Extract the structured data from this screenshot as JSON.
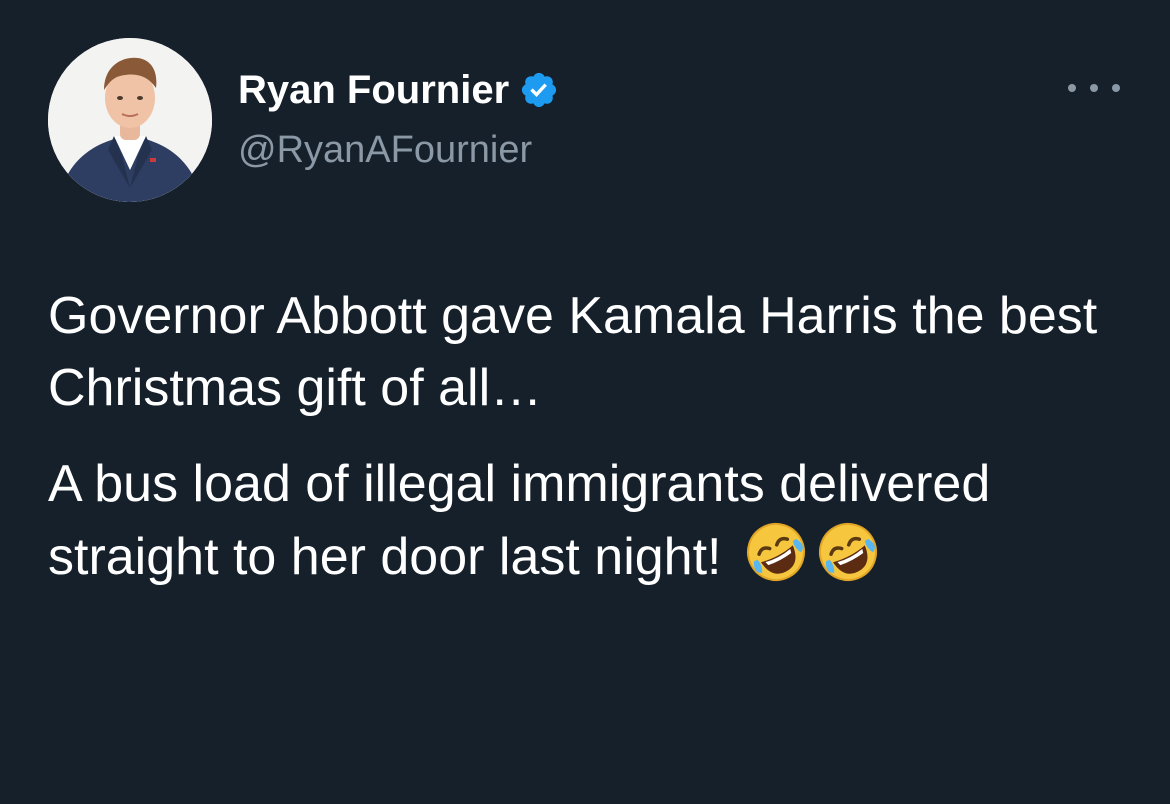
{
  "tweet": {
    "author": {
      "display_name": "Ryan Fournier",
      "handle": "@RyanAFournier",
      "verified": true
    },
    "paragraphs": [
      "Governor Abbott gave Kamala Harris the best Christmas gift of all…",
      "A bus load of illegal immigrants delivered straight to her door last night!"
    ],
    "emojis": [
      "rolling-on-floor-laughing-icon",
      "rolling-on-floor-laughing-icon"
    ]
  },
  "colors": {
    "background": "#15202b",
    "text_primary": "#ffffff",
    "text_secondary": "#8b98a5",
    "verified_blue": "#1d9bf0"
  }
}
